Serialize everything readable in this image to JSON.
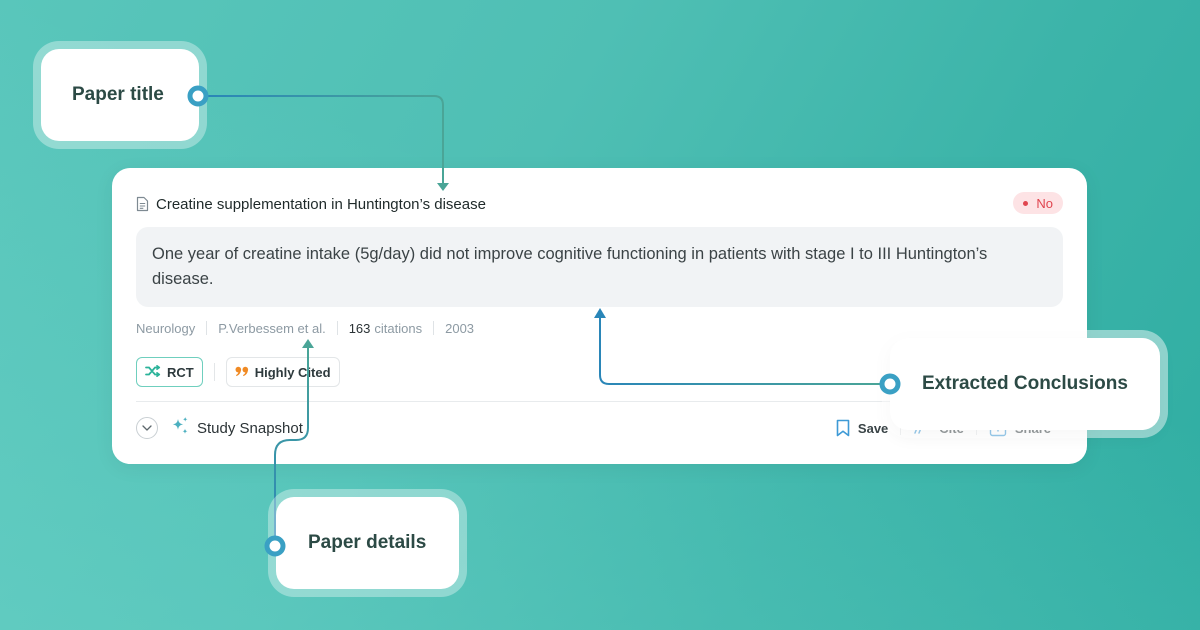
{
  "callouts": {
    "paper_title": "Paper title",
    "extracted_conclusions": "Extracted Conclusions",
    "paper_details": "Paper details"
  },
  "card": {
    "title": "Creatine supplementation in Huntington’s disease",
    "title_icon": "document-icon",
    "verdict_badge": {
      "label": "No",
      "color": "#e0454f"
    },
    "conclusion": "One year of creatine intake (5g/day) did not improve cognitive functioning in patients with stage I to III Huntington’s disease.",
    "meta": {
      "field": "Neurology",
      "authors": "P.Verbessem et al.",
      "citation_count": "163",
      "citations_label": "citations",
      "year": "2003"
    },
    "tags": [
      {
        "label": "RCT",
        "icon": "shuffle-icon",
        "color": "#2bb39a"
      },
      {
        "label": "Highly Cited",
        "icon": "quote-icon",
        "color": "#f08a24"
      }
    ],
    "footer": {
      "expand_icon": "chevron-down-icon",
      "snapshot_icon": "sparkles-icon",
      "snapshot_label": "Study Snapshot",
      "actions": [
        {
          "label": "Save",
          "icon": "bookmark-icon"
        },
        {
          "label": "Cite",
          "icon": "quote-icon"
        },
        {
          "label": "Share",
          "icon": "share-icon"
        }
      ]
    }
  },
  "colors": {
    "background_from": "#59c6bb",
    "background_to": "#2fada2",
    "connector_blue": "#2a86b8",
    "connector_teal": "#4aa597",
    "callout_text": "#2c4a45"
  }
}
